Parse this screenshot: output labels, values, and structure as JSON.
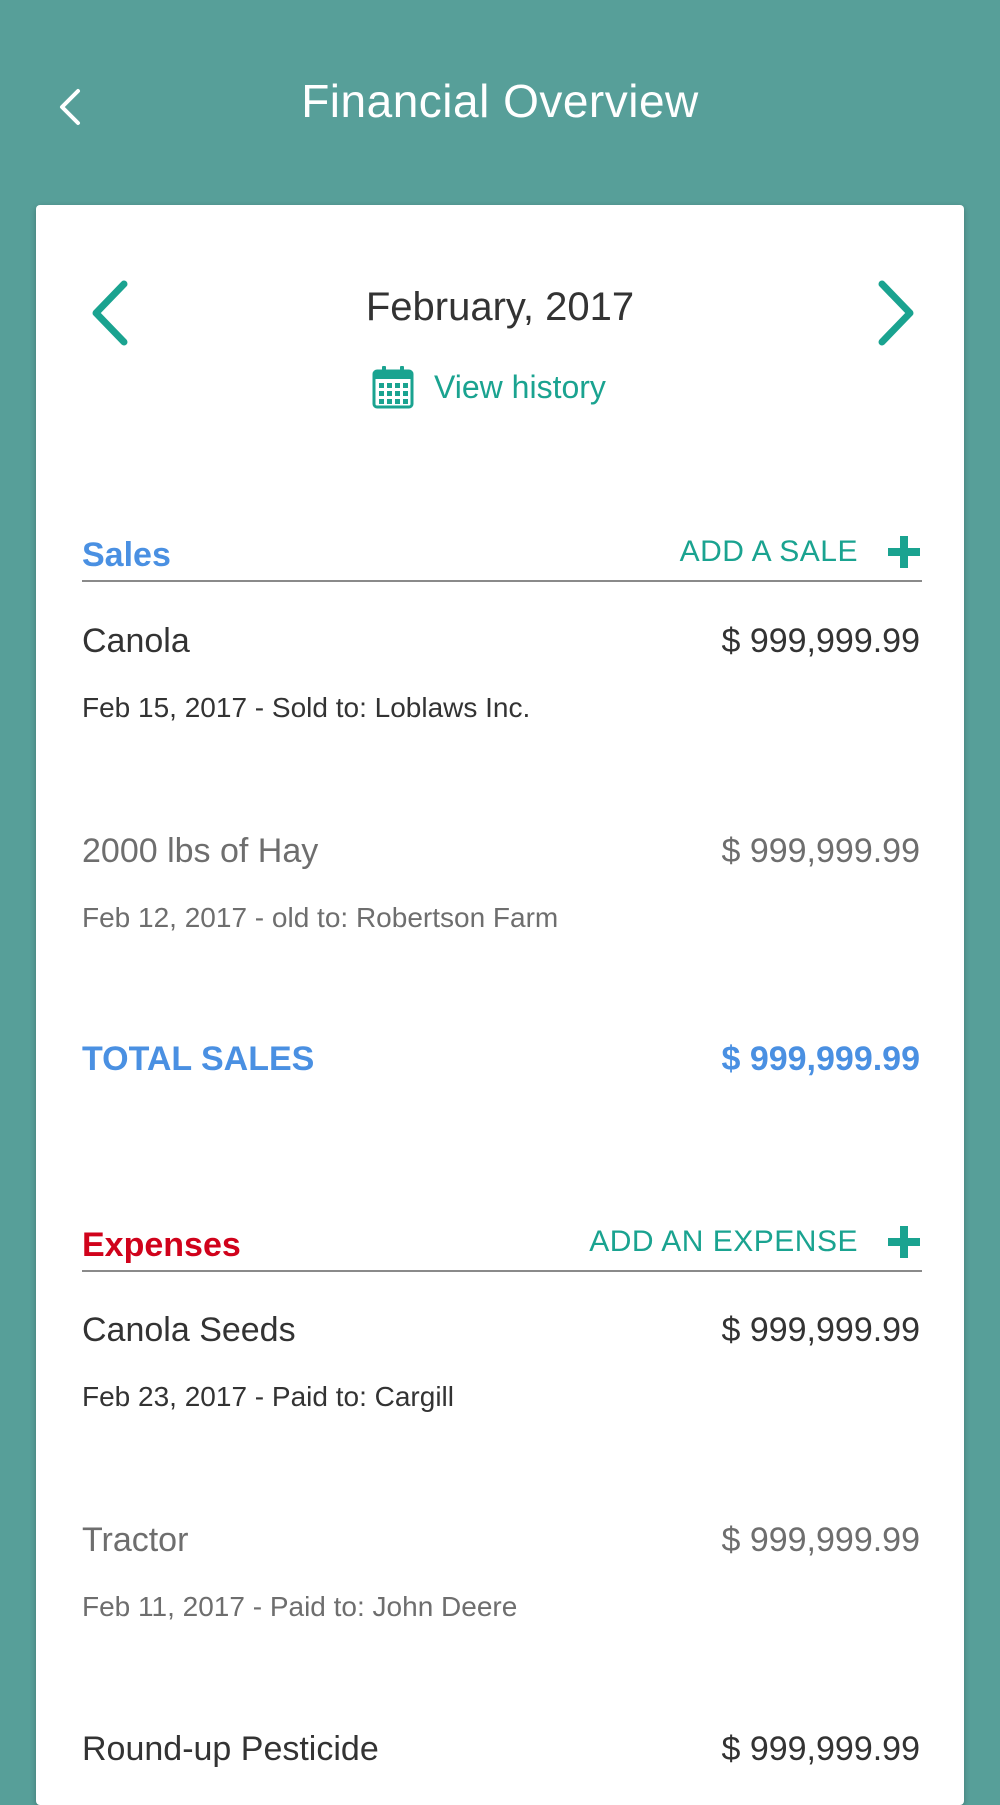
{
  "header": {
    "title": "Financial Overview",
    "back_icon": "chevron-left-icon"
  },
  "period": {
    "label": "February, 2017",
    "prev_icon": "chevron-left-icon",
    "next_icon": "chevron-right-icon",
    "view_history_label": "View history",
    "view_history_icon": "calendar-icon"
  },
  "sales": {
    "title": "Sales",
    "add_label": "ADD A SALE",
    "add_icon": "plus-icon",
    "items": [
      {
        "name": "Canola",
        "amount": "$ 999,999.99",
        "detail": "Feb 15, 2017 - Sold to: Loblaws Inc."
      },
      {
        "name": "2000 lbs of Hay",
        "amount": "$ 999,999.99",
        "detail": "Feb 12, 2017 - old to: Robertson Farm"
      }
    ],
    "total_label": "TOTAL SALES",
    "total_amount": "$ 999,999.99"
  },
  "expenses": {
    "title": "Expenses",
    "add_label": "ADD AN EXPENSE",
    "add_icon": "plus-icon",
    "items": [
      {
        "name": "Canola Seeds",
        "amount": "$ 999,999.99",
        "detail": "Feb 23, 2017 - Paid to: Cargill"
      },
      {
        "name": "Tractor",
        "amount": "$ 999,999.99",
        "detail": "Feb 11, 2017 - Paid to: John Deere"
      },
      {
        "name": "Round-up Pesticide",
        "amount": "$ 999,999.99"
      }
    ]
  },
  "colors": {
    "header_bg": "#579f99",
    "accent_teal": "#1aa390",
    "sales_blue": "#4a90e2",
    "expenses_red": "#d0021b"
  }
}
